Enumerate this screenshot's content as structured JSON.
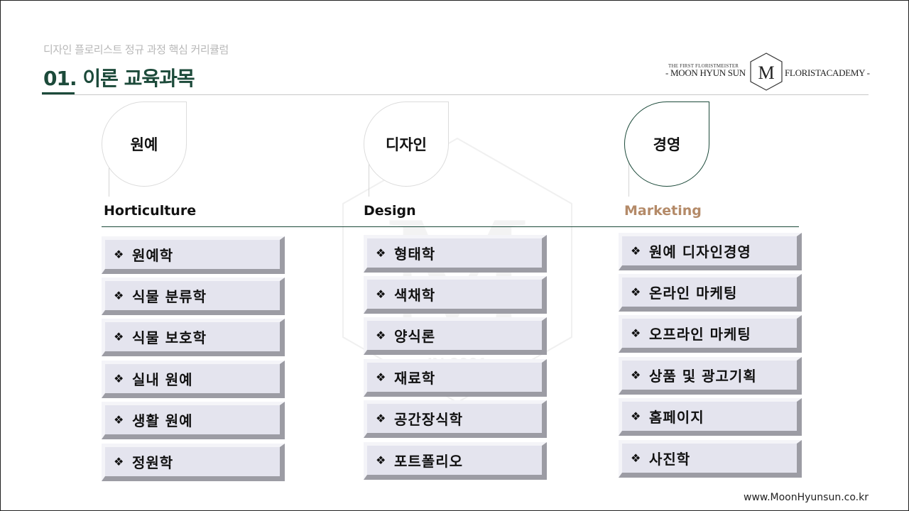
{
  "header": {
    "subtitle": "디자인 플로리스트 정규 과정 핵심 커리큘럼",
    "title": "01. 이론 교육과목"
  },
  "logo": {
    "small_text": "THE FIRST FLORISTMEISTER",
    "left_text": "- MOON HYUN SUN",
    "right_text": "FLORISTACADEMY -",
    "emblem_text": "M"
  },
  "watermark": {
    "text": "IN 2001"
  },
  "bullet_symbol": "❖",
  "columns": [
    {
      "leaf_label": "원예",
      "category": "Horticulture",
      "items": [
        "원예학",
        "식물 분류학",
        "식물 보호학",
        "실내 원예",
        "생활 원예",
        "정원학"
      ]
    },
    {
      "leaf_label": "디자인",
      "category": "Design",
      "items": [
        "형태학",
        "색채학",
        "양식론",
        "재료학",
        "공간장식학",
        "포트폴리오"
      ]
    },
    {
      "leaf_label": "경영",
      "category": "Marketing",
      "items": [
        "원예 디자인경영",
        "온라인 마케팅",
        "오프라인 마케팅",
        "상품 및 광고기획",
        "홈페이지",
        "사진학"
      ]
    }
  ],
  "colors": {
    "primary": "#1c4a3a",
    "accent": "#b48a68",
    "item_bg": "#e4e4ee"
  },
  "footer": {
    "website": "www.MoonHyunsun.co.kr"
  }
}
